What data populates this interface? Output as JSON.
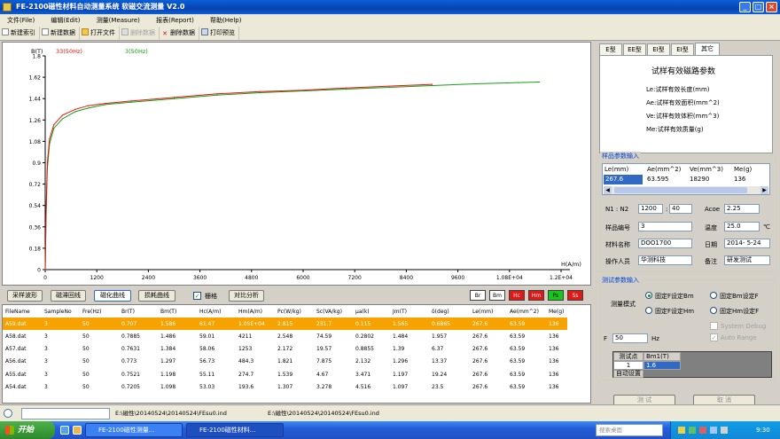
{
  "window": {
    "title": "FE-2100磁性材料自动测量系统  软磁交流测量  V2.0"
  },
  "menu": [
    "文件(File)",
    "编辑(Edit)",
    "测量(Measure)",
    "报表(Report)",
    "帮助(Help)"
  ],
  "toolbar": [
    {
      "label": "新建索引",
      "icon": "new-index-icon",
      "enabled": true
    },
    {
      "label": "新建数据",
      "icon": "new-data-icon",
      "enabled": true
    },
    {
      "label": "打开文件",
      "icon": "open-folder-icon",
      "enabled": true
    },
    {
      "label": "删除数据",
      "icon": "delete-data-icon",
      "enabled": false
    },
    {
      "label": "删除数据",
      "icon": "delete-cross-icon",
      "enabled": true
    },
    {
      "label": "打印预览",
      "icon": "print-preview-icon",
      "enabled": true
    }
  ],
  "chart_data": {
    "type": "line",
    "ylabel": "B(T)",
    "xlabel": "H(A/m)",
    "ylim": [
      0,
      1.8
    ],
    "yticks": [
      "0",
      "0.18",
      "0.36",
      "0.54",
      "0.72",
      "0.9",
      "1.08",
      "1.26",
      "1.44",
      "1.62",
      "1.8"
    ],
    "xlim": [
      0,
      12000
    ],
    "xticks": [
      "0",
      "1200",
      "2400",
      "3600",
      "4800",
      "6000",
      "7200",
      "8400",
      "9600",
      "1.08E+04",
      "1.2E+04"
    ],
    "grid": false,
    "legend_placement": "top-left",
    "series": [
      {
        "name": "33(50Hz)",
        "color": "#e81010",
        "x": [
          0,
          20,
          50,
          100,
          200,
          400,
          700,
          1000,
          1400,
          2000,
          3000,
          4000,
          5000,
          6000,
          7000,
          8000,
          9000
        ],
        "y": [
          0,
          0.5,
          0.9,
          1.1,
          1.22,
          1.3,
          1.35,
          1.38,
          1.4,
          1.42,
          1.45,
          1.48,
          1.5,
          1.51,
          1.53,
          1.545,
          1.56
        ]
      },
      {
        "name": "3(50Hz)",
        "color": "#10a010",
        "x": [
          0,
          20,
          50,
          100,
          200,
          400,
          700,
          1000,
          1400,
          2000,
          3000,
          4000,
          5000,
          6000,
          7000,
          8000,
          9000,
          10000,
          11000,
          11500
        ],
        "y": [
          0,
          0.45,
          0.85,
          1.06,
          1.19,
          1.27,
          1.33,
          1.36,
          1.39,
          1.41,
          1.44,
          1.47,
          1.49,
          1.505,
          1.52,
          1.535,
          1.55,
          1.565,
          1.575,
          1.58
        ]
      }
    ]
  },
  "controls": {
    "buttons": [
      "采样波形",
      "磁滞回线",
      "磁化曲线",
      "损耗曲线",
      "对比分析"
    ],
    "grid_checkbox_label": "栅格",
    "color_swatches": [
      {
        "label": "Br",
        "bg": "#ffffff",
        "fg": "#000000"
      },
      {
        "label": "Bm",
        "bg": "#ffffff",
        "fg": "#000000"
      },
      {
        "label": "Hc",
        "bg": "#e01818",
        "fg": "#ffffff"
      },
      {
        "label": "Hm",
        "bg": "#e01818",
        "fg": "#ffffff"
      },
      {
        "label": "Ps",
        "bg": "#18c818",
        "fg": "#000000"
      },
      {
        "label": "Ss",
        "bg": "#e01818",
        "fg": "#ffffff"
      }
    ]
  },
  "table": {
    "columns": [
      "FileName",
      "SampleNo",
      "Fre(Hz)",
      "Br(T)",
      "Bm(T)",
      "Hc(A/m)",
      "Hm(A/m)",
      "Pc(W/kg)",
      "Sc(VA/kg)",
      "μa(k)",
      "Jm(T)",
      "δ(deg)",
      "Le(mm)",
      "Ae(mm^2)",
      "Me(g)"
    ],
    "rows": [
      [
        "A59.dat",
        "3",
        "50",
        "0.707",
        "1.586",
        "61.47",
        "1.05E+04",
        "2.815",
        "231.7",
        "0.115",
        "1.565",
        "0.6865",
        "267.6",
        "63.59",
        "136"
      ],
      [
        "A58.dat",
        "3",
        "50",
        "0.7885",
        "1.486",
        "59.01",
        "4211",
        "2.548",
        "74.59",
        "0.2802",
        "1.484",
        "1.957",
        "267.6",
        "63.59",
        "136"
      ],
      [
        "A57.dat",
        "3",
        "50",
        "0.7631",
        "1.384",
        "58.06",
        "1253",
        "2.172",
        "19.57",
        "0.8855",
        "1.39",
        "6.37",
        "267.6",
        "63.59",
        "136"
      ],
      [
        "A56.dat",
        "3",
        "50",
        "0.773",
        "1.297",
        "56.73",
        "484.3",
        "1.821",
        "7.875",
        "2.132",
        "1.296",
        "13.37",
        "267.6",
        "63.59",
        "136"
      ],
      [
        "A55.dat",
        "3",
        "50",
        "0.7521",
        "1.198",
        "55.11",
        "274.7",
        "1.539",
        "4.67",
        "3.471",
        "1.197",
        "19.24",
        "267.6",
        "63.59",
        "136"
      ],
      [
        "A54.dat",
        "3",
        "50",
        "0.7205",
        "1.098",
        "53.03",
        "193.6",
        "1.307",
        "3.278",
        "4.516",
        "1.097",
        "23.5",
        "267.6",
        "63.59",
        "136"
      ]
    ]
  },
  "right_panel": {
    "tabs": [
      "E型",
      "EE型",
      "EI型",
      "EI型",
      "其它"
    ],
    "active_tab": "其它",
    "params_title": "试样有效磁路参数",
    "params": [
      "Le:试样有效长度(mm)",
      "Ae:试样有效面积(mm^2)",
      "Ve:试样有效体积(mm^3)",
      "Me:试样有效质量(g)"
    ],
    "sample_group": "样品参数输入",
    "sample_cols": [
      "Le(mm)",
      "Ae(mm^2)",
      "Ve(mm^3)",
      "Me(g)"
    ],
    "sample_vals": [
      "267.6",
      "63.595",
      "18290",
      "136"
    ],
    "n_label": "N1 : N2",
    "n1": "1200",
    "n2": "40",
    "acoe_label": "Acoe",
    "acoe": "2.25",
    "sample_no_label": "样品编号",
    "sample_no": "3",
    "temp_label": "温度",
    "temp": "25.0",
    "temp_unit": "℃",
    "material_label": "材料名称",
    "material": "DOO1700",
    "date_label": "日期",
    "date": "2014- 5-24",
    "operator_label": "操作人员",
    "operator": "华测科技",
    "remark_label": "备注",
    "remark": "研发测试",
    "test_group": "测试参数输入",
    "mode_label": "测量模式",
    "modes": [
      "固定F设定Bm",
      "固定Bm设定F",
      "固定F设定Hm",
      "固定Hm设定F"
    ],
    "system_debug": "System Debug",
    "auto_range": "Auto Range",
    "f_label": "F",
    "f_value": "50",
    "f_unit": "Hz",
    "grid_head": [
      "测试点",
      "Bm1(T)"
    ],
    "grid_row": [
      "1",
      "1.6"
    ],
    "auto_set": "自动设置",
    "test_btn": "测 试",
    "cancel_btn": "取 消"
  },
  "status": {
    "path1": "E:\\磁性\\20140524\\20140524\\FEsu0.ind",
    "path2": "E:\\磁性\\20140524\\20140524\\FEsu0.ind"
  },
  "taskbar": {
    "start": "开始",
    "tasks": [
      "FE-2100磁性测量...",
      "FE-2100磁性材料..."
    ],
    "search_placeholder": "搜索桌面",
    "time": "9:30"
  }
}
